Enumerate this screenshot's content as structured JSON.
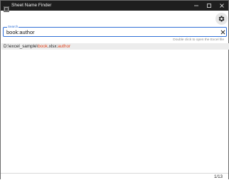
{
  "window": {
    "title": "Sheet Name Finder",
    "icon": "excel-app-icon"
  },
  "titlebar_buttons": [
    "minimize-icon",
    "maximize-icon",
    "close-icon"
  ],
  "toolbar": {
    "settings_icon": "gear-icon"
  },
  "search": {
    "legend": "Search",
    "value": "book:author",
    "clear_icon": "close-icon",
    "accent": "#2f6fd6"
  },
  "hint": "Double click to open the Excel file",
  "results": [
    {
      "prefix": "D:\\excel_sample\\",
      "match_file": "book",
      "ext": ".xlsx:",
      "match_sheet": "author"
    }
  ],
  "highlight_color": "#e0451f",
  "status": {
    "count": "1/13"
  }
}
